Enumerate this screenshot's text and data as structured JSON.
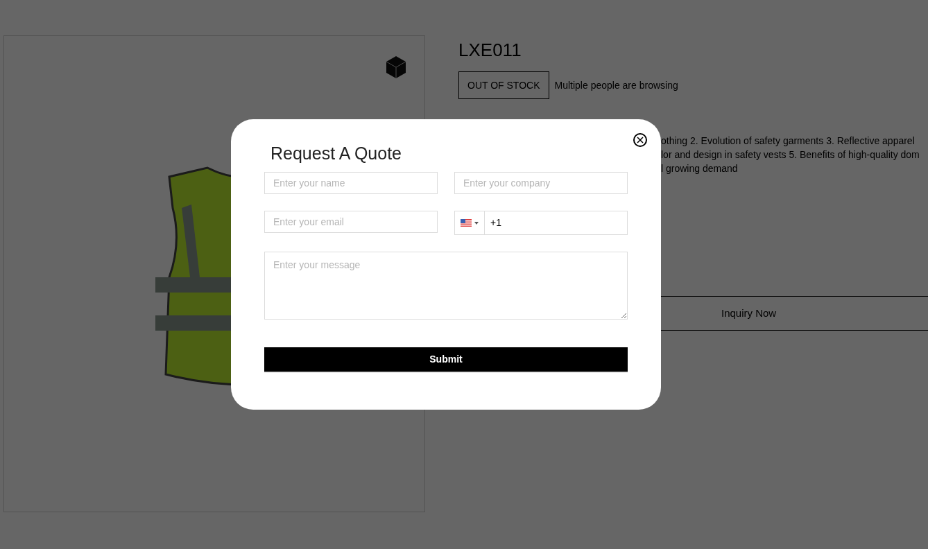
{
  "product": {
    "title": "LXE011",
    "stock_badge": "OUT OF STOCK",
    "browsing_note": "Multiple people are browsing",
    "description_lines": [
      "othing 2. Evolution of safety garments 3. Reflective apparel",
      "lor and design in safety vests 5. Benefits of high-quality dom",
      "l growing demand"
    ],
    "inquiry_button": "Inquiry Now"
  },
  "modal": {
    "title": "Request A Quote",
    "fields": [
      {
        "placeholder": "Enter your name"
      },
      {
        "placeholder": "Enter your company"
      },
      {
        "placeholder": "Enter your email"
      }
    ],
    "phone": {
      "value": "+1"
    },
    "message": {
      "placeholder": "Enter your message"
    },
    "submit": "Submit"
  }
}
